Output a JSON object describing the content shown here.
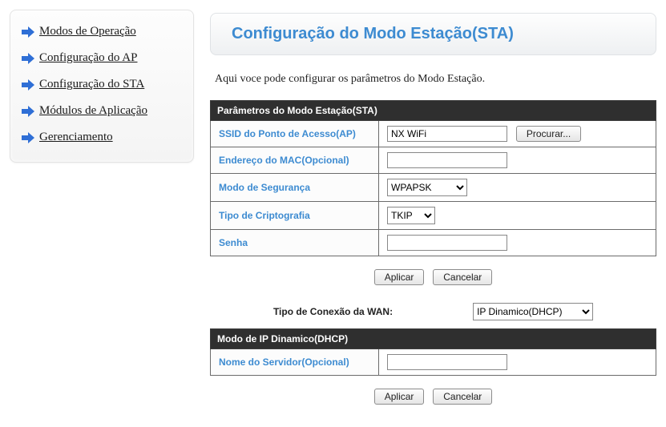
{
  "sidebar": {
    "items": [
      {
        "label": "Modos de Operação"
      },
      {
        "label": "Configuração do AP"
      },
      {
        "label": "Configuração do STA"
      },
      {
        "label": "Módulos de Aplicação"
      },
      {
        "label": "Gerenciamento"
      }
    ]
  },
  "header": {
    "title": "Configuração do Modo Estação(STA)"
  },
  "intro": "Aqui voce pode configurar os parâmetros do Modo Estação.",
  "section1": {
    "header": "Parâmetros do Modo Estação(STA)",
    "rows": {
      "ssid": {
        "label": "SSID do Ponto de Acesso(AP)",
        "value": "NX WiFi",
        "browse": "Procurar..."
      },
      "mac": {
        "label": "Endereço do MAC(Opcional)",
        "value": ""
      },
      "security": {
        "label": "Modo de Segurança",
        "selected": "WPAPSK"
      },
      "crypto": {
        "label": "Tipo de Criptografia",
        "selected": "TKIP"
      },
      "password": {
        "label": "Senha",
        "value": ""
      }
    }
  },
  "buttons": {
    "apply": "Aplicar",
    "cancel": "Cancelar"
  },
  "wan": {
    "label": "Tipo de Conexão da WAN:",
    "selected": "IP Dinamico(DHCP)"
  },
  "section2": {
    "header": "Modo de IP Dinamico(DHCP)",
    "rows": {
      "server": {
        "label": "Nome do Servidor(Opcional)",
        "value": ""
      }
    }
  }
}
